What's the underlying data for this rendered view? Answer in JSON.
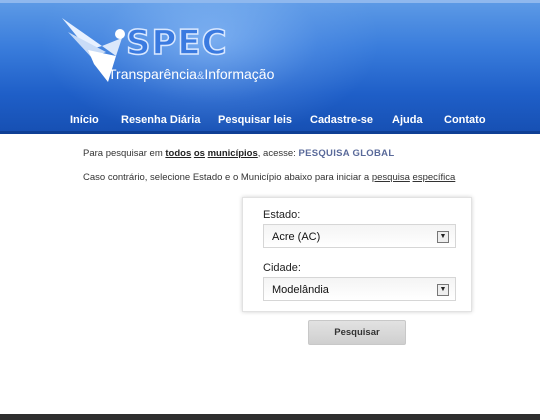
{
  "brand": {
    "name": "SPEC",
    "tagline_part1": "Transparência",
    "tagline_amp": "&",
    "tagline_part2": "Informação"
  },
  "nav": {
    "items": [
      "Início",
      "Resenha Diária",
      "Pesquisar leis",
      "Cadastre-se",
      "Ajuda",
      "Contato"
    ]
  },
  "intro": {
    "line1_prefix": "Para pesquisar em ",
    "line1_todos": "todos",
    "line1_os": "os",
    "line1_municipios": "municípios",
    "line1_mid": ", acesse: ",
    "line1_link": "PESQUISA GLOBAL",
    "line2_prefix": "Caso contrário, selecione Estado e o Município abaixo para iniciar a ",
    "line2_pesquisa": "pesquisa",
    "line2_especifica": "específica"
  },
  "form": {
    "estado_label": "Estado:",
    "estado_value": "Acre (AC)",
    "cidade_label": "Cidade:",
    "cidade_value": "Modelândia",
    "submit_label": "Pesquisar"
  }
}
